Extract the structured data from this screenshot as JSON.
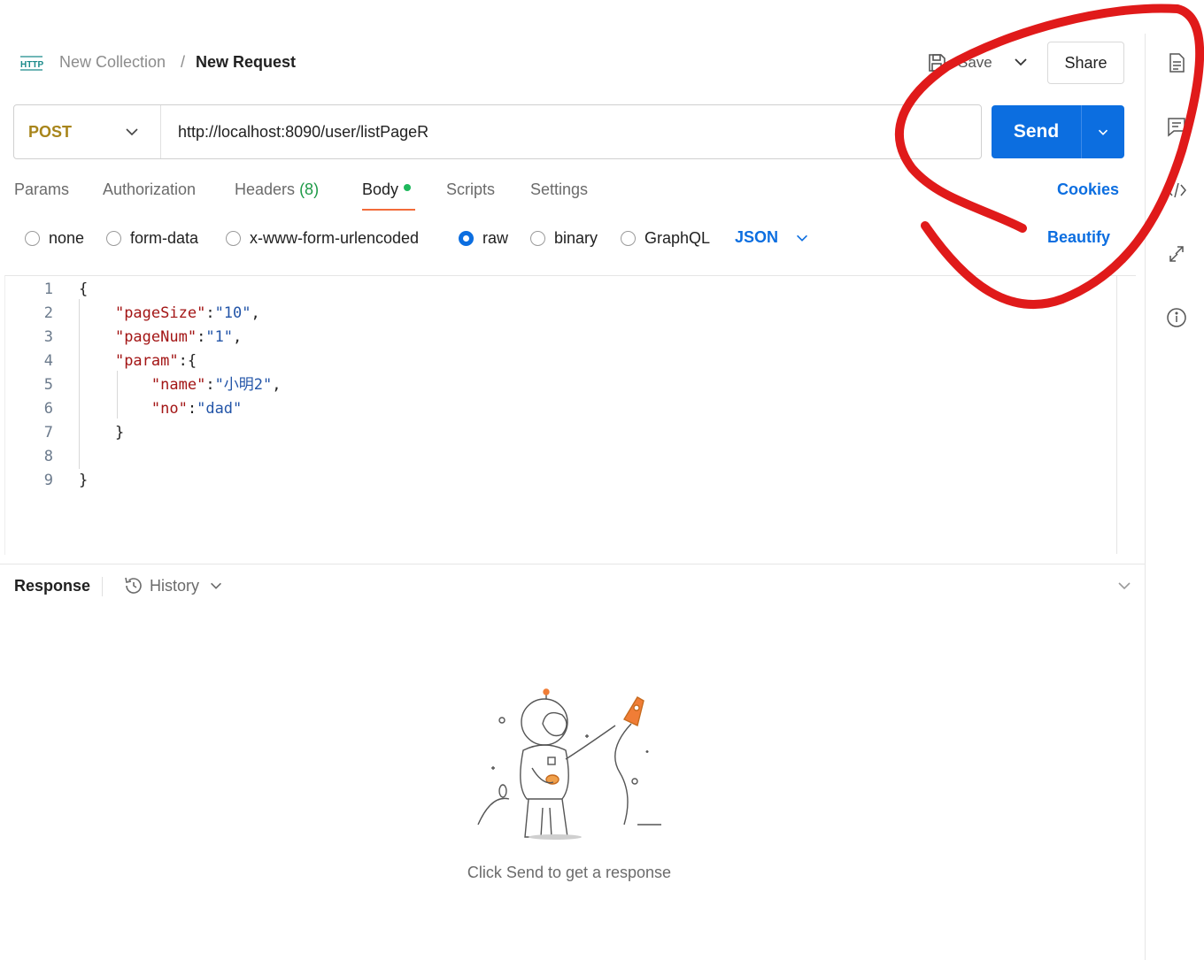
{
  "header": {
    "breadcrumb_parent": "New Collection",
    "breadcrumb_separator": "/",
    "breadcrumb_current": "New Request",
    "save_label": "Save",
    "share_label": "Share"
  },
  "request": {
    "method": "POST",
    "url": "http://localhost:8090/user/listPageR",
    "send_label": "Send"
  },
  "tabs": [
    {
      "label": "Params"
    },
    {
      "label": "Authorization"
    },
    {
      "label": "Headers",
      "count": "(8)"
    },
    {
      "label": "Body",
      "active": true
    },
    {
      "label": "Scripts"
    },
    {
      "label": "Settings"
    }
  ],
  "cookies_label": "Cookies",
  "body_types": [
    {
      "label": "none",
      "checked": false
    },
    {
      "label": "form-data",
      "checked": false
    },
    {
      "label": "x-www-form-urlencoded",
      "checked": false
    },
    {
      "label": "raw",
      "checked": true
    },
    {
      "label": "binary",
      "checked": false
    },
    {
      "label": "GraphQL",
      "checked": false
    }
  ],
  "raw_format": "JSON",
  "beautify_label": "Beautify",
  "editor": {
    "line_numbers": [
      "1",
      "2",
      "3",
      "4",
      "5",
      "6",
      "7",
      "8",
      "9"
    ],
    "lines": [
      "{",
      "    \"pageSize\":\"10\",",
      "    \"pageNum\":\"1\",",
      "    \"param\":{",
      "        \"name\":\"小明2\",",
      "        \"no\":\"dad\"",
      "    }",
      "",
      "}"
    ]
  },
  "response": {
    "title": "Response",
    "history_label": "History",
    "empty_message": "Click Send to get a response"
  },
  "colors": {
    "accent": "#0c6ee0",
    "method": "#a8851b",
    "annotation": "#e01a1a",
    "active_tab_underline": "#f26b3a"
  },
  "sidebar_icons": [
    "documentation-icon",
    "comments-icon",
    "code-icon",
    "related-requests-icon",
    "info-icon"
  ]
}
